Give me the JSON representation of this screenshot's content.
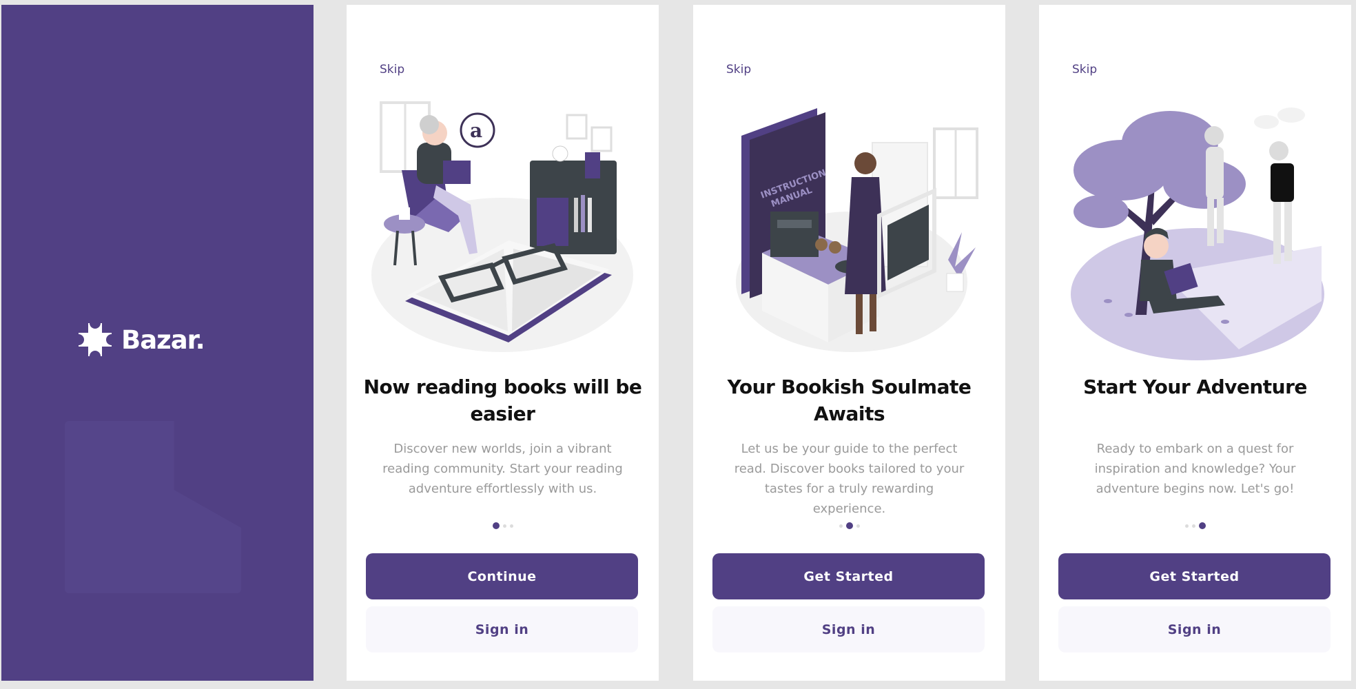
{
  "splash": {
    "brand": "Bazar."
  },
  "screens": [
    {
      "skip": "Skip",
      "title": "Now reading books will be easier",
      "description": "Discover new worlds, join a vibrant reading community. Start your reading adventure effortlessly with us.",
      "page_index": 0,
      "primary_label": "Continue",
      "secondary_label": "Sign in"
    },
    {
      "skip": "Skip",
      "title": "Your Bookish Soulmate Awaits",
      "description": "Let us be your guide to the perfect read. Discover books tailored to your tastes for a truly rewarding experience.",
      "page_index": 1,
      "primary_label": "Get Started",
      "secondary_label": "Sign in"
    },
    {
      "skip": "Skip",
      "title": "Start Your Adventure",
      "description": "Ready to embark on a quest for inspiration and knowledge? Your adventure begins now. Let's go!",
      "page_index": 2,
      "primary_label": "Get Started",
      "secondary_label": "Sign in"
    }
  ],
  "colors": {
    "primary": "#514084",
    "secondary_bg": "#f8f7fc",
    "muted_text": "#9a9a9a",
    "title_text": "#111111"
  }
}
